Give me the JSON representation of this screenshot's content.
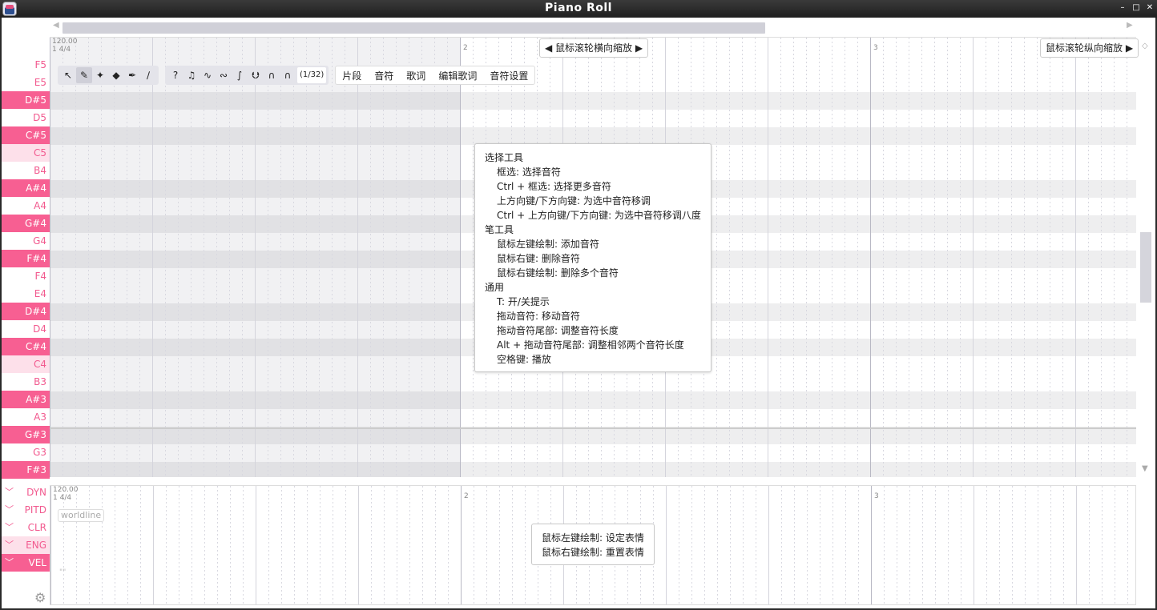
{
  "window": {
    "title": "Piano Roll",
    "buttons": [
      "–",
      "□",
      "✕"
    ]
  },
  "ruler": {
    "tempo": "120.00",
    "time_sig": "1 4/4",
    "bars": [
      "2",
      "3"
    ]
  },
  "zoom_hints": {
    "horizontal": "◀ 鼠标滚轮横向缩放 ▶",
    "vertical": "鼠标滚轮纵向缩放 ▶"
  },
  "keys": [
    {
      "label": "F5",
      "black": false
    },
    {
      "label": "E5",
      "black": false
    },
    {
      "label": "D#5",
      "black": true
    },
    {
      "label": "D5",
      "black": false
    },
    {
      "label": "C#5",
      "black": true
    },
    {
      "label": "C5",
      "black": false,
      "c": true
    },
    {
      "label": "B4",
      "black": false
    },
    {
      "label": "A#4",
      "black": true
    },
    {
      "label": "A4",
      "black": false
    },
    {
      "label": "G#4",
      "black": true
    },
    {
      "label": "G4",
      "black": false
    },
    {
      "label": "F#4",
      "black": true
    },
    {
      "label": "F4",
      "black": false
    },
    {
      "label": "E4",
      "black": false
    },
    {
      "label": "D#4",
      "black": true
    },
    {
      "label": "D4",
      "black": false
    },
    {
      "label": "C#4",
      "black": true
    },
    {
      "label": "C4",
      "black": false,
      "c": true
    },
    {
      "label": "B3",
      "black": false
    },
    {
      "label": "A#3",
      "black": true
    },
    {
      "label": "A3",
      "black": false
    },
    {
      "label": "G#3",
      "black": true
    },
    {
      "label": "G3",
      "black": false
    },
    {
      "label": "F#3",
      "black": true
    }
  ],
  "toolbar": {
    "tools": [
      {
        "name": "select-tool",
        "glyph": "↖",
        "active": false
      },
      {
        "name": "pen-tool",
        "glyph": "✎",
        "active": true
      },
      {
        "name": "pen-plus-tool",
        "glyph": "✦",
        "active": false
      },
      {
        "name": "eraser-tool",
        "glyph": "◆",
        "active": false
      },
      {
        "name": "draw-pitch-tool",
        "glyph": "✒",
        "active": false
      },
      {
        "name": "knife-tool",
        "glyph": "∕",
        "active": false
      }
    ],
    "view_toggles": [
      {
        "name": "show-tips",
        "glyph": "?"
      },
      {
        "name": "note-icon",
        "glyph": "♫"
      },
      {
        "name": "vibrato-icon",
        "glyph": "∿"
      },
      {
        "name": "pitch-points-icon",
        "glyph": "∾"
      },
      {
        "name": "pitch-curve-icon",
        "glyph": "∫"
      },
      {
        "name": "waveform-icon",
        "glyph": "⮋"
      },
      {
        "name": "phoneme-icon",
        "glyph": "∩"
      },
      {
        "name": "snap-magnet-icon",
        "glyph": "∩"
      }
    ],
    "snap": "(1/32)",
    "menus": [
      "片段",
      "音符",
      "歌词",
      "编辑歌词",
      "音符设置"
    ]
  },
  "tooltip": {
    "lines": [
      {
        "text": "选择工具",
        "indent": false
      },
      {
        "text": "框选: 选择音符",
        "indent": true
      },
      {
        "text": "Ctrl + 框选: 选择更多音符",
        "indent": true
      },
      {
        "text": "上方向键/下方向键: 为选中音符移调",
        "indent": true
      },
      {
        "text": "Ctrl + 上方向键/下方向键: 为选中音符移调八度",
        "indent": true
      },
      {
        "text": "笔工具",
        "indent": false
      },
      {
        "text": "鼠标左键绘制: 添加音符",
        "indent": true
      },
      {
        "text": "鼠标右键: 删除音符",
        "indent": true
      },
      {
        "text": "鼠标右键绘制: 删除多个音符",
        "indent": true
      },
      {
        "text": "通用",
        "indent": false
      },
      {
        "text": "T: 开/关提示",
        "indent": true
      },
      {
        "text": "拖动音符: 移动音符",
        "indent": true
      },
      {
        "text": "拖动音符尾部: 调整音符长度",
        "indent": true
      },
      {
        "text": "Alt + 拖动音符尾部: 调整相邻两个音符长度",
        "indent": true
      },
      {
        "text": "空格键: 播放",
        "indent": true
      }
    ]
  },
  "expressions": [
    {
      "label": "DYN",
      "state": "off"
    },
    {
      "label": "PITD",
      "state": "off"
    },
    {
      "label": "CLR",
      "state": "off"
    },
    {
      "label": "ENG",
      "state": "on"
    },
    {
      "label": "VEL",
      "state": "selected"
    }
  ],
  "expression_pane": {
    "worldline": "worldline",
    "quote": "\"\"",
    "tip": [
      "鼠标左键绘制: 设定表情",
      "鼠标右键绘制: 重置表情"
    ]
  }
}
